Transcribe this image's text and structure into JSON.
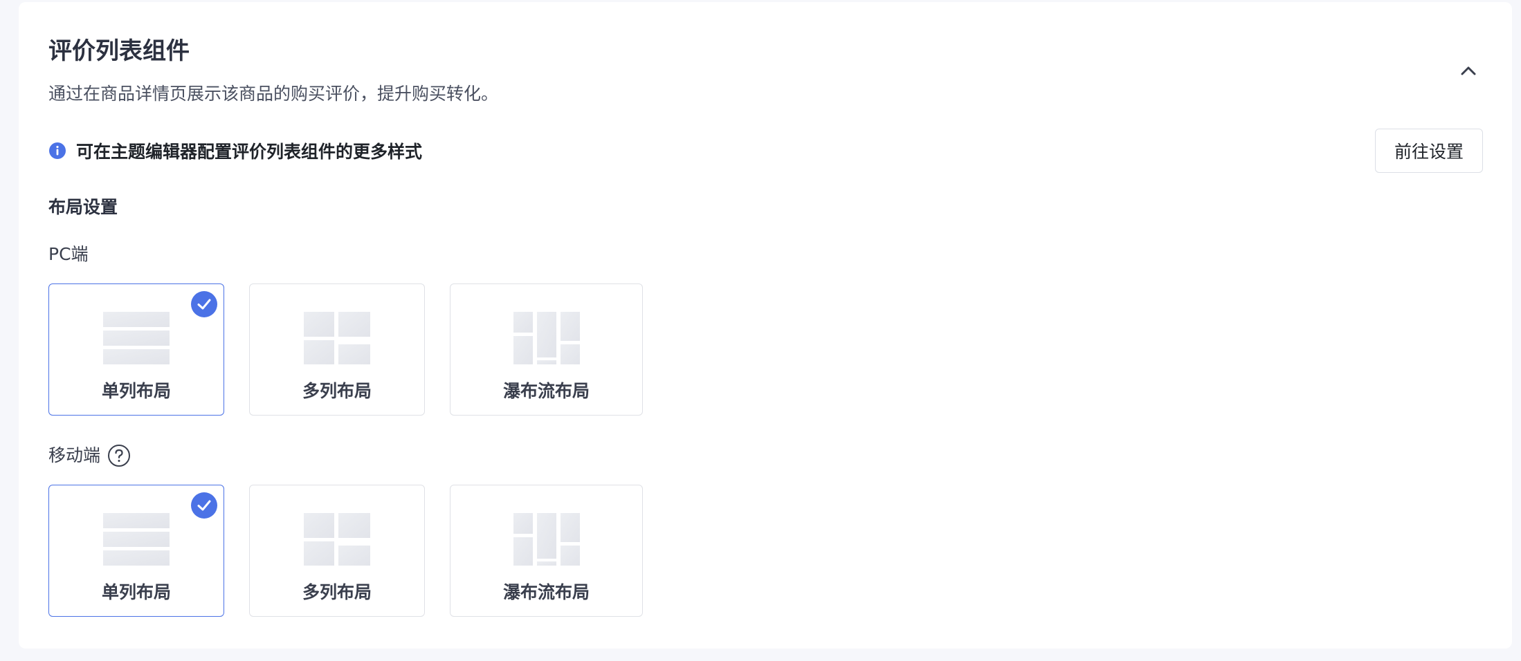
{
  "header": {
    "title": "评价列表组件",
    "description": "通过在商品详情页展示该商品的购买评价，提升购买转化。",
    "collapse_icon": "chevron-up-icon"
  },
  "notice": {
    "icon": "info-icon",
    "text": "可在主题编辑器配置评价列表组件的更多样式",
    "button_label": "前往设置"
  },
  "layout_settings": {
    "label": "布局设置",
    "pc": {
      "label": "PC端",
      "options": [
        {
          "label": "单列布局",
          "selected": true
        },
        {
          "label": "多列布局",
          "selected": false
        },
        {
          "label": "瀑布流布局",
          "selected": false
        }
      ]
    },
    "mobile": {
      "label": "移动端",
      "help_icon": "question-circle-icon",
      "options": [
        {
          "label": "单列布局",
          "selected": true
        },
        {
          "label": "多列布局",
          "selected": false
        },
        {
          "label": "瀑布流布局",
          "selected": false
        }
      ]
    }
  },
  "colors": {
    "accent": "#4b72e6",
    "info": "#4b72e6",
    "thumb": "#e8e9ee"
  }
}
